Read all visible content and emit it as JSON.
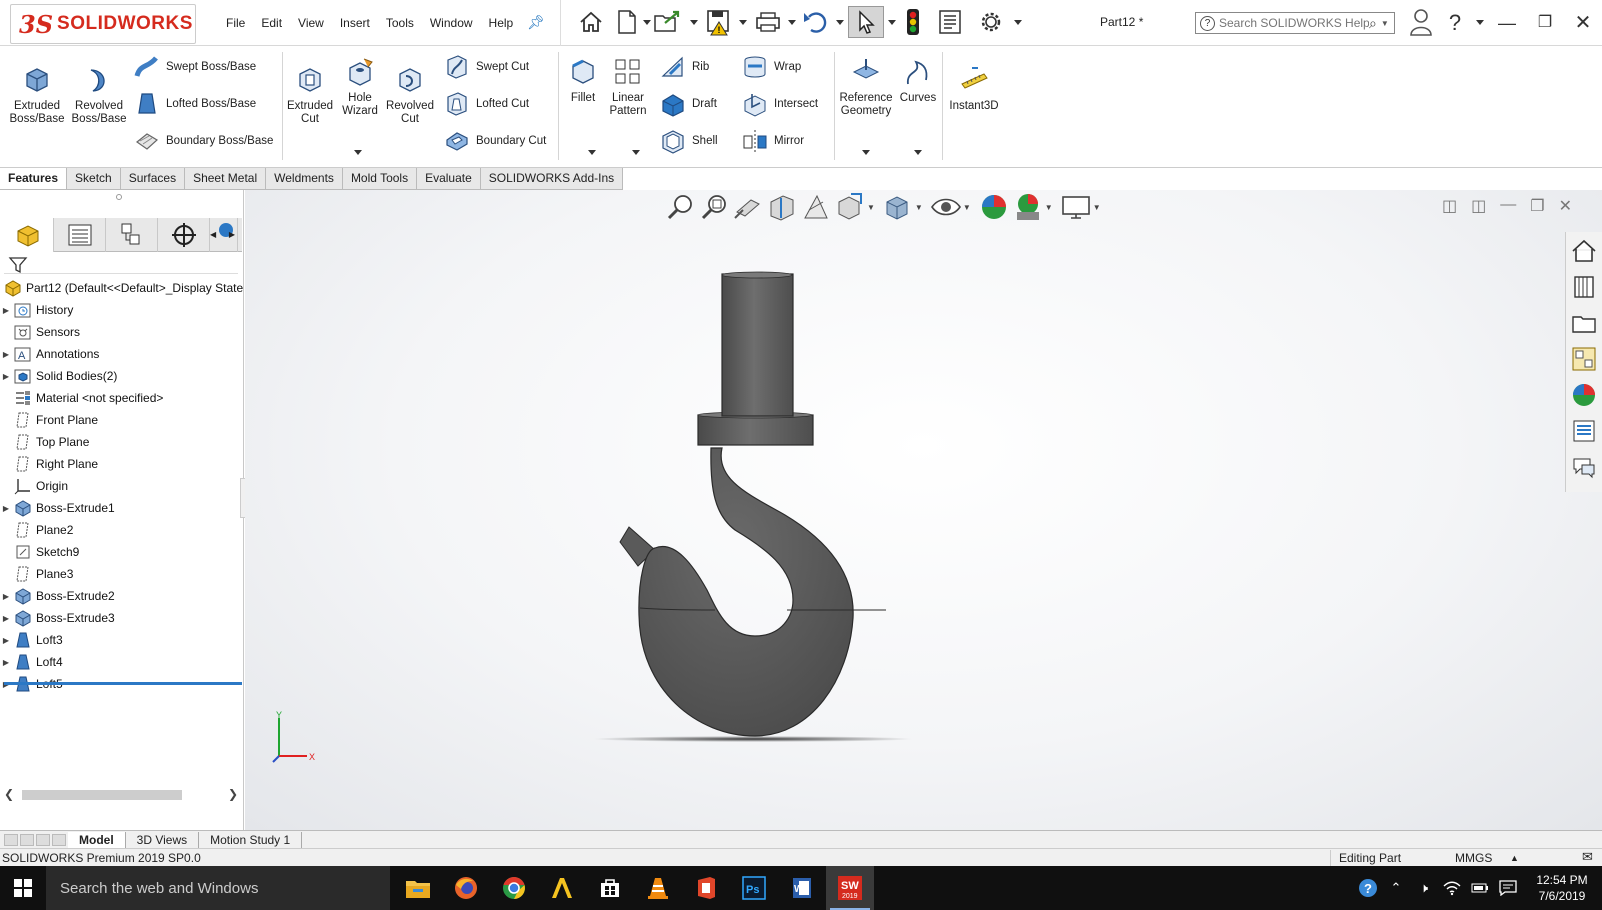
{
  "app": {
    "logo_ds": "3S",
    "logo_text": "SOLIDWORKS",
    "document_title": "Part12 *"
  },
  "menu": [
    "File",
    "Edit",
    "View",
    "Insert",
    "Tools",
    "Window",
    "Help"
  ],
  "search": {
    "placeholder": "Search SOLIDWORKS Help"
  },
  "ribbon": {
    "extruded_boss": "Extruded Boss/Base",
    "revolved_boss": "Revolved Boss/Base",
    "swept_boss": "Swept Boss/Base",
    "lofted_boss": "Lofted Boss/Base",
    "boundary_boss": "Boundary Boss/Base",
    "extruded_cut": "Extruded Cut",
    "hole_wizard": "Hole Wizard",
    "revolved_cut": "Revolved Cut",
    "swept_cut": "Swept Cut",
    "lofted_cut": "Lofted Cut",
    "boundary_cut": "Boundary Cut",
    "fillet": "Fillet",
    "linear_pattern": "Linear Pattern",
    "rib": "Rib",
    "draft": "Draft",
    "shell": "Shell",
    "wrap": "Wrap",
    "intersect": "Intersect",
    "mirror": "Mirror",
    "reference_geometry": "Reference Geometry",
    "curves": "Curves",
    "instant3d": "Instant3D"
  },
  "tabs": [
    "Features",
    "Sketch",
    "Surfaces",
    "Sheet Metal",
    "Weldments",
    "Mold Tools",
    "Evaluate",
    "SOLIDWORKS Add-Ins"
  ],
  "tree": [
    {
      "label": "Part12  (Default<<Default>_Display State",
      "expandable": false,
      "icon": "part-icon"
    },
    {
      "label": "History",
      "expandable": true,
      "icon": "history-icon"
    },
    {
      "label": "Sensors",
      "expandable": false,
      "icon": "sensors-icon"
    },
    {
      "label": "Annotations",
      "expandable": true,
      "icon": "annotations-icon"
    },
    {
      "label": "Solid Bodies(2)",
      "expandable": true,
      "icon": "solid-bodies-icon"
    },
    {
      "label": "Material <not specified>",
      "expandable": false,
      "icon": "material-icon"
    },
    {
      "label": "Front Plane",
      "expandable": false,
      "icon": "plane-icon"
    },
    {
      "label": "Top Plane",
      "expandable": false,
      "icon": "plane-icon"
    },
    {
      "label": "Right Plane",
      "expandable": false,
      "icon": "plane-icon"
    },
    {
      "label": "Origin",
      "expandable": false,
      "icon": "origin-icon"
    },
    {
      "label": "Boss-Extrude1",
      "expandable": true,
      "icon": "extrude-icon"
    },
    {
      "label": "Plane2",
      "expandable": false,
      "icon": "plane-icon"
    },
    {
      "label": "Sketch9",
      "expandable": false,
      "icon": "sketch-icon"
    },
    {
      "label": "Plane3",
      "expandable": false,
      "icon": "plane-icon"
    },
    {
      "label": "Boss-Extrude2",
      "expandable": true,
      "icon": "extrude-icon"
    },
    {
      "label": "Boss-Extrude3",
      "expandable": true,
      "icon": "extrude-icon"
    },
    {
      "label": "Loft3",
      "expandable": true,
      "icon": "loft-icon"
    },
    {
      "label": "Loft4",
      "expandable": true,
      "icon": "loft-icon"
    },
    {
      "label": "Loft5",
      "expandable": true,
      "icon": "loft-icon"
    }
  ],
  "triad": {
    "y_label": "Y",
    "x_label": "X"
  },
  "bottom_tabs": [
    "Model",
    "3D Views",
    "Motion Study 1"
  ],
  "status": {
    "product": "SOLIDWORKS Premium 2019 SP0.0",
    "mode": "Editing Part",
    "units": "MMGS"
  },
  "taskbar": {
    "search_placeholder": "Search the web and Windows",
    "time": "12:54 PM",
    "date": "7/6/2019",
    "sw_badge": "2019"
  },
  "colors": {
    "brand_red": "#d52b1e",
    "model_gray": "#5c5c5c",
    "selection_blue": "#2b78c5"
  }
}
